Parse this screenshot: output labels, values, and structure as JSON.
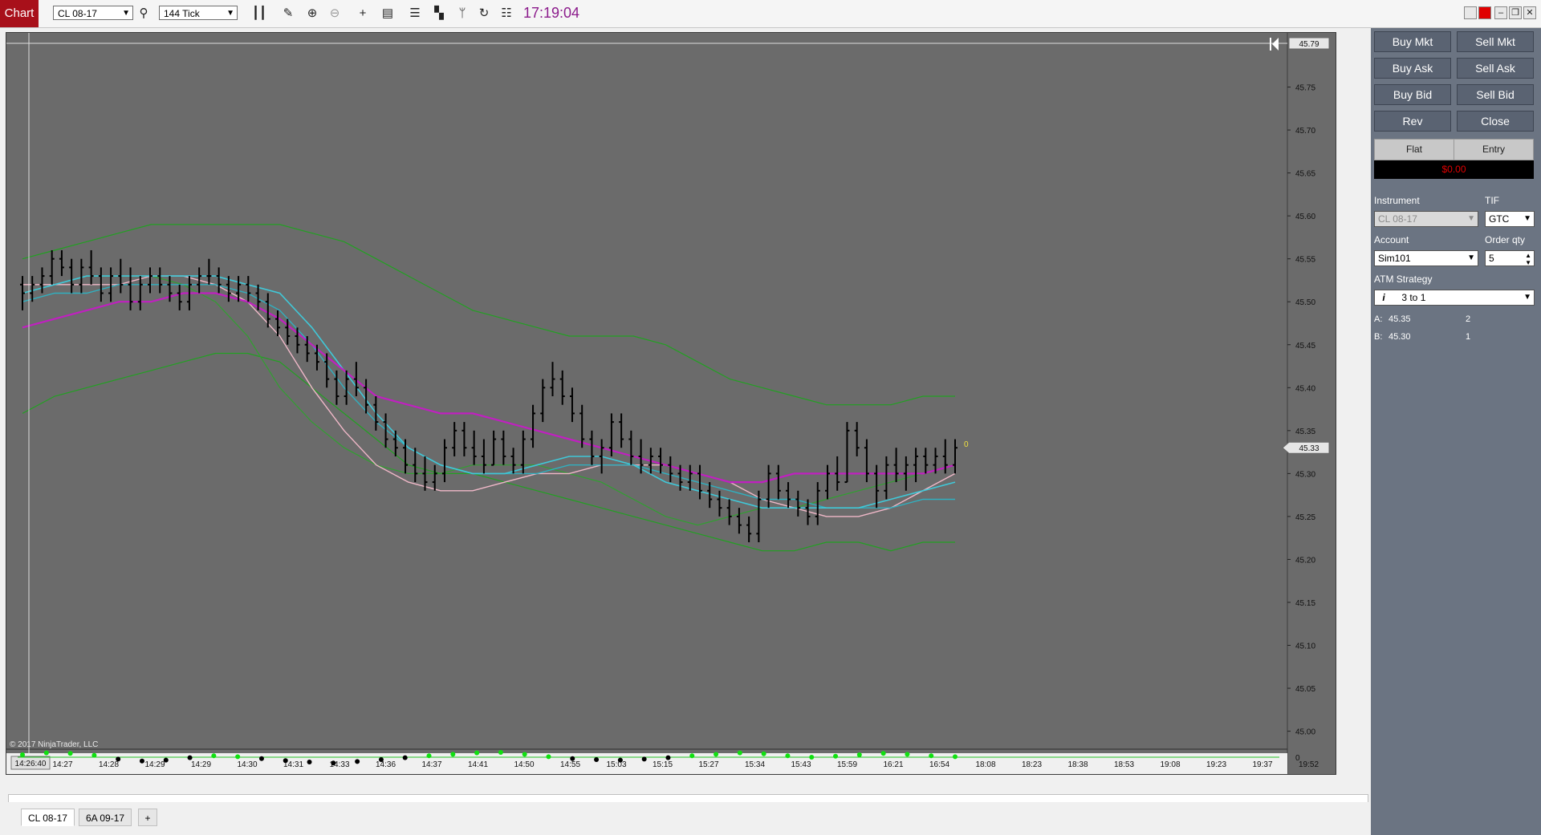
{
  "toolbar": {
    "chart_label": "Chart",
    "instrument_select": "CL 08-17",
    "interval_select": "144 Tick",
    "clock": "17:19:04"
  },
  "chart": {
    "price_ticks": [
      "45.75",
      "45.70",
      "45.65",
      "45.60",
      "45.55",
      "45.50",
      "45.45",
      "45.40",
      "45.35",
      "45.30",
      "45.25",
      "45.20",
      "45.15",
      "45.10",
      "45.05",
      "45.00"
    ],
    "price_top_marker": "45.79",
    "price_current_marker": "45.33",
    "last_tick_marker": "0",
    "indicator_zero": "0",
    "copyright": "© 2017 NinjaTrader, LLC",
    "crosshair_time": "14:26:40",
    "time_ticks": [
      "14:27",
      "14:28",
      "14:29",
      "14:29",
      "14:30",
      "14:31",
      "14:33",
      "14:36",
      "14:37",
      "14:41",
      "14:50",
      "14:55",
      "15:03",
      "15:15",
      "15:27",
      "15:34",
      "15:43",
      "15:59",
      "16:21",
      "16:54",
      "18:08",
      "18:23",
      "18:38",
      "18:53",
      "19:08",
      "19:23",
      "19:37",
      "19:52"
    ]
  },
  "chart_data": {
    "type": "line",
    "y_axis": {
      "min": 44.98,
      "max": 45.8
    },
    "bars": [
      {
        "o": 45.52,
        "h": 45.53,
        "l": 45.49,
        "c": 45.51
      },
      {
        "o": 45.51,
        "h": 45.53,
        "l": 45.5,
        "c": 45.52
      },
      {
        "o": 45.52,
        "h": 45.54,
        "l": 45.51,
        "c": 45.53
      },
      {
        "o": 45.53,
        "h": 45.56,
        "l": 45.52,
        "c": 45.55
      },
      {
        "o": 45.55,
        "h": 45.56,
        "l": 45.53,
        "c": 45.54
      },
      {
        "o": 45.54,
        "h": 45.55,
        "l": 45.51,
        "c": 45.52
      },
      {
        "o": 45.52,
        "h": 45.55,
        "l": 45.51,
        "c": 45.54
      },
      {
        "o": 45.54,
        "h": 45.56,
        "l": 45.52,
        "c": 45.53
      },
      {
        "o": 45.53,
        "h": 45.54,
        "l": 45.5,
        "c": 45.51
      },
      {
        "o": 45.51,
        "h": 45.54,
        "l": 45.5,
        "c": 45.53
      },
      {
        "o": 45.53,
        "h": 45.55,
        "l": 45.51,
        "c": 45.52
      },
      {
        "o": 45.52,
        "h": 45.54,
        "l": 45.49,
        "c": 45.5
      },
      {
        "o": 45.5,
        "h": 45.53,
        "l": 45.49,
        "c": 45.52
      },
      {
        "o": 45.52,
        "h": 45.54,
        "l": 45.51,
        "c": 45.53
      },
      {
        "o": 45.53,
        "h": 45.54,
        "l": 45.51,
        "c": 45.52
      },
      {
        "o": 45.52,
        "h": 45.53,
        "l": 45.5,
        "c": 45.51
      },
      {
        "o": 45.51,
        "h": 45.52,
        "l": 45.49,
        "c": 45.5
      },
      {
        "o": 45.5,
        "h": 45.53,
        "l": 45.49,
        "c": 45.52
      },
      {
        "o": 45.52,
        "h": 45.54,
        "l": 45.51,
        "c": 45.53
      },
      {
        "o": 45.53,
        "h": 45.55,
        "l": 45.52,
        "c": 45.53
      },
      {
        "o": 45.53,
        "h": 45.54,
        "l": 45.51,
        "c": 45.52
      },
      {
        "o": 45.52,
        "h": 45.53,
        "l": 45.5,
        "c": 45.51
      },
      {
        "o": 45.51,
        "h": 45.53,
        "l": 45.5,
        "c": 45.52
      },
      {
        "o": 45.52,
        "h": 45.53,
        "l": 45.5,
        "c": 45.51
      },
      {
        "o": 45.51,
        "h": 45.52,
        "l": 45.49,
        "c": 45.5
      },
      {
        "o": 45.5,
        "h": 45.51,
        "l": 45.47,
        "c": 45.48
      },
      {
        "o": 45.48,
        "h": 45.49,
        "l": 45.46,
        "c": 45.47
      },
      {
        "o": 45.47,
        "h": 45.48,
        "l": 45.45,
        "c": 45.46
      },
      {
        "o": 45.46,
        "h": 45.47,
        "l": 45.44,
        "c": 45.45
      },
      {
        "o": 45.45,
        "h": 45.46,
        "l": 45.43,
        "c": 45.44
      },
      {
        "o": 45.44,
        "h": 45.45,
        "l": 45.42,
        "c": 45.43
      },
      {
        "o": 45.43,
        "h": 45.44,
        "l": 45.4,
        "c": 45.41
      },
      {
        "o": 45.41,
        "h": 45.42,
        "l": 45.38,
        "c": 45.39
      },
      {
        "o": 45.39,
        "h": 45.42,
        "l": 45.38,
        "c": 45.41
      },
      {
        "o": 45.41,
        "h": 45.43,
        "l": 45.39,
        "c": 45.4
      },
      {
        "o": 45.4,
        "h": 45.41,
        "l": 45.37,
        "c": 45.38
      },
      {
        "o": 45.38,
        "h": 45.39,
        "l": 45.35,
        "c": 45.36
      },
      {
        "o": 45.36,
        "h": 45.37,
        "l": 45.33,
        "c": 45.34
      },
      {
        "o": 45.34,
        "h": 45.35,
        "l": 45.32,
        "c": 45.33
      },
      {
        "o": 45.33,
        "h": 45.34,
        "l": 45.3,
        "c": 45.31
      },
      {
        "o": 45.31,
        "h": 45.33,
        "l": 45.29,
        "c": 45.3
      },
      {
        "o": 45.3,
        "h": 45.32,
        "l": 45.28,
        "c": 45.29
      },
      {
        "o": 45.29,
        "h": 45.31,
        "l": 45.28,
        "c": 45.3
      },
      {
        "o": 45.3,
        "h": 45.34,
        "l": 45.29,
        "c": 45.33
      },
      {
        "o": 45.33,
        "h": 45.36,
        "l": 45.32,
        "c": 45.35
      },
      {
        "o": 45.35,
        "h": 45.36,
        "l": 45.32,
        "c": 45.33
      },
      {
        "o": 45.33,
        "h": 45.35,
        "l": 45.31,
        "c": 45.32
      },
      {
        "o": 45.32,
        "h": 45.34,
        "l": 45.3,
        "c": 45.31
      },
      {
        "o": 45.31,
        "h": 45.35,
        "l": 45.31,
        "c": 45.34
      },
      {
        "o": 45.34,
        "h": 45.35,
        "l": 45.31,
        "c": 45.32
      },
      {
        "o": 45.32,
        "h": 45.33,
        "l": 45.3,
        "c": 45.31
      },
      {
        "o": 45.31,
        "h": 45.35,
        "l": 45.3,
        "c": 45.34
      },
      {
        "o": 45.34,
        "h": 45.38,
        "l": 45.33,
        "c": 45.37
      },
      {
        "o": 45.37,
        "h": 45.41,
        "l": 45.36,
        "c": 45.4
      },
      {
        "o": 45.4,
        "h": 45.43,
        "l": 45.39,
        "c": 45.41
      },
      {
        "o": 45.41,
        "h": 45.42,
        "l": 45.38,
        "c": 45.39
      },
      {
        "o": 45.39,
        "h": 45.4,
        "l": 45.36,
        "c": 45.37
      },
      {
        "o": 45.37,
        "h": 45.38,
        "l": 45.33,
        "c": 45.34
      },
      {
        "o": 45.34,
        "h": 45.35,
        "l": 45.31,
        "c": 45.32
      },
      {
        "o": 45.32,
        "h": 45.34,
        "l": 45.3,
        "c": 45.33
      },
      {
        "o": 45.33,
        "h": 45.37,
        "l": 45.32,
        "c": 45.36
      },
      {
        "o": 45.36,
        "h": 45.37,
        "l": 45.33,
        "c": 45.34
      },
      {
        "o": 45.34,
        "h": 45.35,
        "l": 45.31,
        "c": 45.32
      },
      {
        "o": 45.32,
        "h": 45.34,
        "l": 45.3,
        "c": 45.31
      },
      {
        "o": 45.31,
        "h": 45.33,
        "l": 45.3,
        "c": 45.32
      },
      {
        "o": 45.32,
        "h": 45.33,
        "l": 45.3,
        "c": 45.31
      },
      {
        "o": 45.31,
        "h": 45.32,
        "l": 45.29,
        "c": 45.3
      },
      {
        "o": 45.3,
        "h": 45.31,
        "l": 45.28,
        "c": 45.29
      },
      {
        "o": 45.29,
        "h": 45.31,
        "l": 45.28,
        "c": 45.3
      },
      {
        "o": 45.3,
        "h": 45.31,
        "l": 45.27,
        "c": 45.28
      },
      {
        "o": 45.28,
        "h": 45.29,
        "l": 45.26,
        "c": 45.27
      },
      {
        "o": 45.27,
        "h": 45.28,
        "l": 45.25,
        "c": 45.26
      },
      {
        "o": 45.26,
        "h": 45.27,
        "l": 45.24,
        "c": 45.25
      },
      {
        "o": 45.25,
        "h": 45.26,
        "l": 45.23,
        "c": 45.24
      },
      {
        "o": 45.24,
        "h": 45.25,
        "l": 45.22,
        "c": 45.23
      },
      {
        "o": 45.23,
        "h": 45.28,
        "l": 45.22,
        "c": 45.27
      },
      {
        "o": 45.27,
        "h": 45.31,
        "l": 45.26,
        "c": 45.3
      },
      {
        "o": 45.3,
        "h": 45.31,
        "l": 45.27,
        "c": 45.28
      },
      {
        "o": 45.28,
        "h": 45.29,
        "l": 45.26,
        "c": 45.27
      },
      {
        "o": 45.27,
        "h": 45.28,
        "l": 45.25,
        "c": 45.26
      },
      {
        "o": 45.26,
        "h": 45.27,
        "l": 45.24,
        "c": 45.25
      },
      {
        "o": 45.25,
        "h": 45.29,
        "l": 45.24,
        "c": 45.28
      },
      {
        "o": 45.28,
        "h": 45.31,
        "l": 45.27,
        "c": 45.3
      },
      {
        "o": 45.3,
        "h": 45.32,
        "l": 45.28,
        "c": 45.29
      },
      {
        "o": 45.29,
        "h": 45.36,
        "l": 45.29,
        "c": 45.35
      },
      {
        "o": 45.35,
        "h": 45.36,
        "l": 45.32,
        "c": 45.33
      },
      {
        "o": 45.33,
        "h": 45.34,
        "l": 45.29,
        "c": 45.3
      },
      {
        "o": 45.3,
        "h": 45.31,
        "l": 45.26,
        "c": 45.28
      },
      {
        "o": 45.28,
        "h": 45.32,
        "l": 45.27,
        "c": 45.31
      },
      {
        "o": 45.31,
        "h": 45.33,
        "l": 45.29,
        "c": 45.3
      },
      {
        "o": 45.3,
        "h": 45.32,
        "l": 45.28,
        "c": 45.31
      },
      {
        "o": 45.31,
        "h": 45.33,
        "l": 45.29,
        "c": 45.32
      },
      {
        "o": 45.32,
        "h": 45.33,
        "l": 45.3,
        "c": 45.31
      },
      {
        "o": 45.31,
        "h": 45.33,
        "l": 45.3,
        "c": 45.32
      },
      {
        "o": 45.32,
        "h": 45.34,
        "l": 45.3,
        "c": 45.31
      },
      {
        "o": 45.31,
        "h": 45.34,
        "l": 45.3,
        "c": 45.33
      }
    ],
    "bollinger_upper": [
      45.55,
      45.56,
      45.57,
      45.58,
      45.59,
      45.59,
      45.59,
      45.59,
      45.59,
      45.58,
      45.57,
      45.55,
      45.53,
      45.51,
      45.49,
      45.48,
      45.47,
      45.46,
      45.46,
      45.46,
      45.45,
      45.43,
      45.41,
      45.4,
      45.39,
      45.38,
      45.38,
      45.38,
      45.39,
      45.39
    ],
    "bollinger_lower": [
      45.37,
      45.39,
      45.4,
      45.41,
      45.42,
      45.43,
      45.44,
      45.44,
      45.43,
      45.4,
      45.37,
      45.34,
      45.31,
      45.3,
      45.3,
      45.29,
      45.28,
      45.27,
      45.26,
      45.25,
      45.24,
      45.23,
      45.22,
      45.21,
      45.21,
      45.22,
      45.22,
      45.21,
      45.22,
      45.22
    ],
    "ma_magenta": [
      45.47,
      45.48,
      45.49,
      45.5,
      45.5,
      45.51,
      45.51,
      45.5,
      45.48,
      45.45,
      45.42,
      45.39,
      45.38,
      45.37,
      45.37,
      45.36,
      45.35,
      45.34,
      45.33,
      45.32,
      45.31,
      45.3,
      45.29,
      45.29,
      45.3,
      45.3,
      45.3,
      45.3,
      45.3,
      45.31
    ],
    "ma_pink": [
      45.52,
      45.52,
      45.52,
      45.52,
      45.53,
      45.53,
      45.52,
      45.5,
      45.46,
      45.4,
      45.35,
      45.31,
      45.29,
      45.28,
      45.28,
      45.29,
      45.3,
      45.3,
      45.31,
      45.31,
      45.31,
      45.3,
      45.29,
      45.27,
      45.26,
      45.25,
      45.25,
      45.26,
      45.28,
      45.3
    ],
    "ma_cyan": [
      45.51,
      45.52,
      45.53,
      45.53,
      45.53,
      45.53,
      45.53,
      45.52,
      45.51,
      45.47,
      45.42,
      45.37,
      45.33,
      45.31,
      45.3,
      45.3,
      45.31,
      45.32,
      45.32,
      45.31,
      45.29,
      45.28,
      45.27,
      45.26,
      45.26,
      45.26,
      45.26,
      45.27,
      45.28,
      45.29
    ],
    "ma_teal": [
      45.5,
      45.51,
      45.51,
      45.52,
      45.52,
      45.52,
      45.52,
      45.51,
      45.49,
      45.45,
      45.4,
      45.36,
      45.33,
      45.31,
      45.3,
      45.3,
      45.3,
      45.31,
      45.31,
      45.31,
      45.3,
      45.29,
      45.28,
      45.27,
      45.27,
      45.26,
      45.26,
      45.26,
      45.27,
      45.27
    ],
    "ma_green": [
      45.51,
      45.52,
      45.53,
      45.53,
      45.53,
      45.52,
      45.5,
      45.46,
      45.4,
      45.36,
      45.33,
      45.31,
      45.3,
      45.3,
      45.31,
      45.31,
      45.31,
      45.3,
      45.29,
      45.27,
      45.25,
      45.24,
      45.25,
      45.26,
      45.26,
      45.27,
      45.28,
      45.29,
      45.3,
      45.31
    ],
    "oscillator": [
      0.5,
      0.9,
      0.8,
      0.4,
      -0.4,
      -0.8,
      -0.6,
      -0.1,
      0.3,
      0.1,
      -0.3,
      -0.7,
      -1.0,
      -1.2,
      -0.9,
      -0.5,
      -0.1,
      0.3,
      0.6,
      0.9,
      1.0,
      0.6,
      0.1,
      -0.3,
      -0.5,
      -0.6,
      -0.4,
      -0.1,
      0.3,
      0.6,
      0.9,
      0.7,
      0.3,
      0.0,
      0.2,
      0.5,
      0.8,
      0.6,
      0.3,
      0.1
    ],
    "colors": {
      "bars": "#000000",
      "bollinger": "#22a022",
      "ma_magenta": "#c020c0",
      "ma_pink": "#f0b8c8",
      "ma_cyan": "#40c8d8",
      "ma_teal": "#30b0c0",
      "ma_green": "#30a030",
      "oscillator_dots": "#10e010"
    }
  },
  "order_panel": {
    "buttons": {
      "buy_mkt": "Buy Mkt",
      "sell_mkt": "Sell Mkt",
      "buy_ask": "Buy Ask",
      "sell_ask": "Sell Ask",
      "buy_bid": "Buy Bid",
      "sell_bid": "Sell Bid",
      "rev": "Rev",
      "close": "Close"
    },
    "position": "Flat",
    "entry": "Entry",
    "pnl": "$0.00",
    "instrument_label": "Instrument",
    "instrument_value": "CL 08-17",
    "tif_label": "TIF",
    "tif_value": "GTC",
    "account_label": "Account",
    "account_value": "Sim101",
    "order_qty_label": "Order qty",
    "order_qty_value": "5",
    "atm_label": "ATM Strategy",
    "atm_value": "3 to 1",
    "atm_info_icon": "i",
    "target_a_label": "A:",
    "target_a_price": "45.35",
    "target_a_qty": "2",
    "target_b_label": "B:",
    "target_b_price": "45.30",
    "target_b_qty": "1"
  },
  "tabs": [
    "CL 08-17",
    "6A 09-17"
  ],
  "tab_add": "+"
}
